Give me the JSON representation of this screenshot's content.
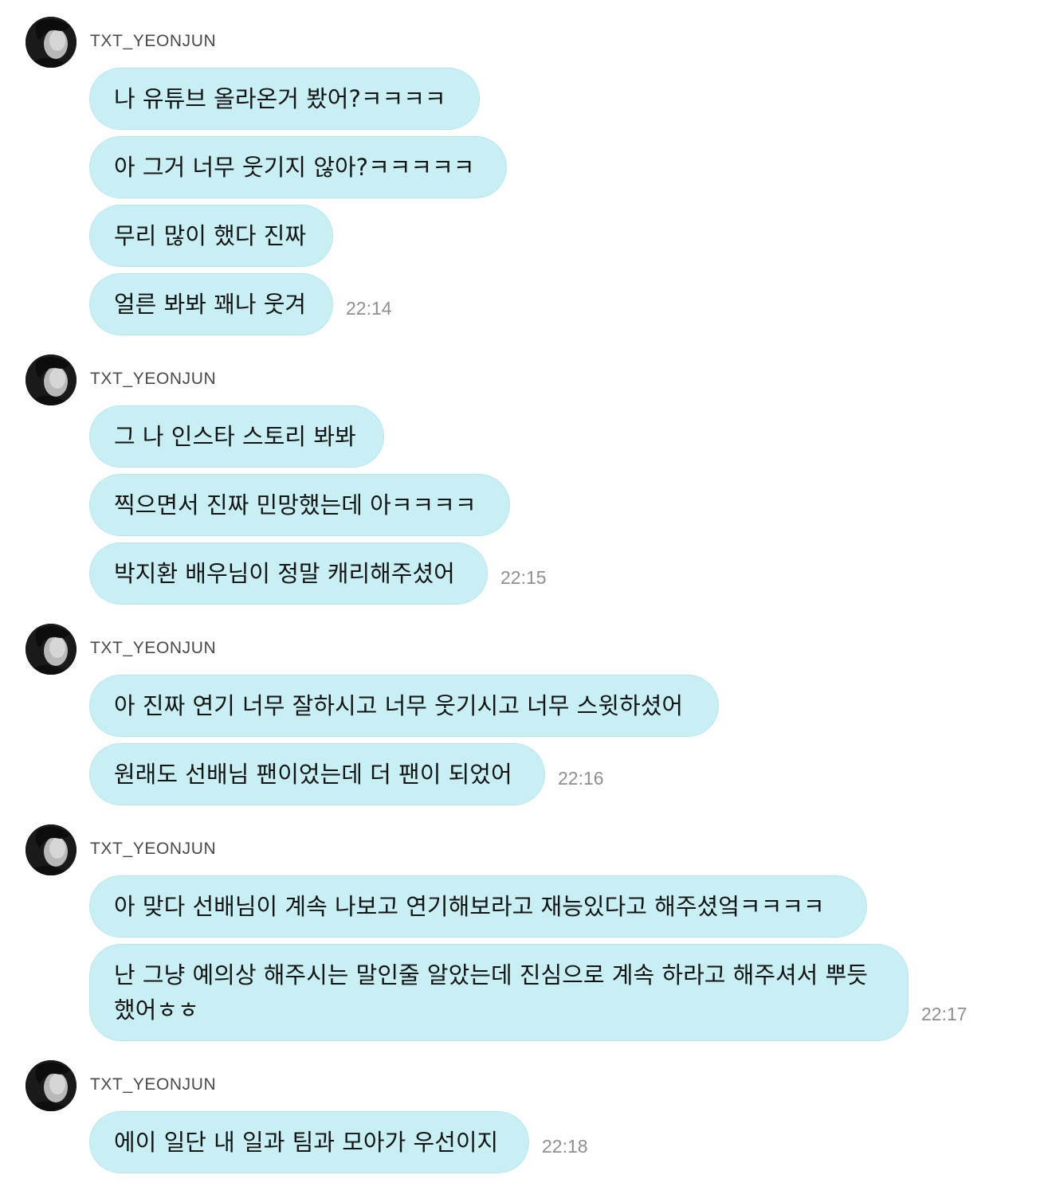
{
  "chat": {
    "groups": [
      {
        "sender": "TXT_YEONJUN",
        "messages": [
          "나 유튜브 올라온거 봤어?ㅋㅋㅋㅋ",
          "아 그거 너무 웃기지 않아?ㅋㅋㅋㅋㅋ",
          "무리 많이 했다 진짜",
          "얼른 봐봐 꽤나 웃겨"
        ],
        "time": "22:14"
      },
      {
        "sender": "TXT_YEONJUN",
        "messages": [
          "그 나 인스타 스토리 봐봐",
          "찍으면서 진짜 민망했는데 아ㅋㅋㅋㅋ",
          "박지환 배우님이 정말 캐리해주셨어"
        ],
        "time": "22:15"
      },
      {
        "sender": "TXT_YEONJUN",
        "messages": [
          "아 진짜 연기 너무 잘하시고 너무 웃기시고 너무 스윗하셨어",
          "원래도 선배님 팬이었는데 더 팬이 되었어"
        ],
        "time": "22:16"
      },
      {
        "sender": "TXT_YEONJUN",
        "messages": [
          "아 맞다 선배님이 계속 나보고 연기해보라고 재능있다고 해주셨엌ㅋㅋㅋㅋ",
          "난 그냥 예의상 해주시는 말인줄 알았는데 진심으로 계속 하라고 해주셔서 뿌듯했어ㅎㅎ"
        ],
        "time": "22:17"
      },
      {
        "sender": "TXT_YEONJUN",
        "messages": [
          "에이 일단 내 일과 팀과 모아가 우선이지"
        ],
        "time": "22:18"
      }
    ],
    "colors": {
      "bubble": "#c8f0f4",
      "bubble_border": "#b6e6ec",
      "timestamp": "#8f8f8f",
      "sender": "#4a4a4a"
    },
    "icons": {
      "avatar": "profile-photo-avatar"
    }
  }
}
